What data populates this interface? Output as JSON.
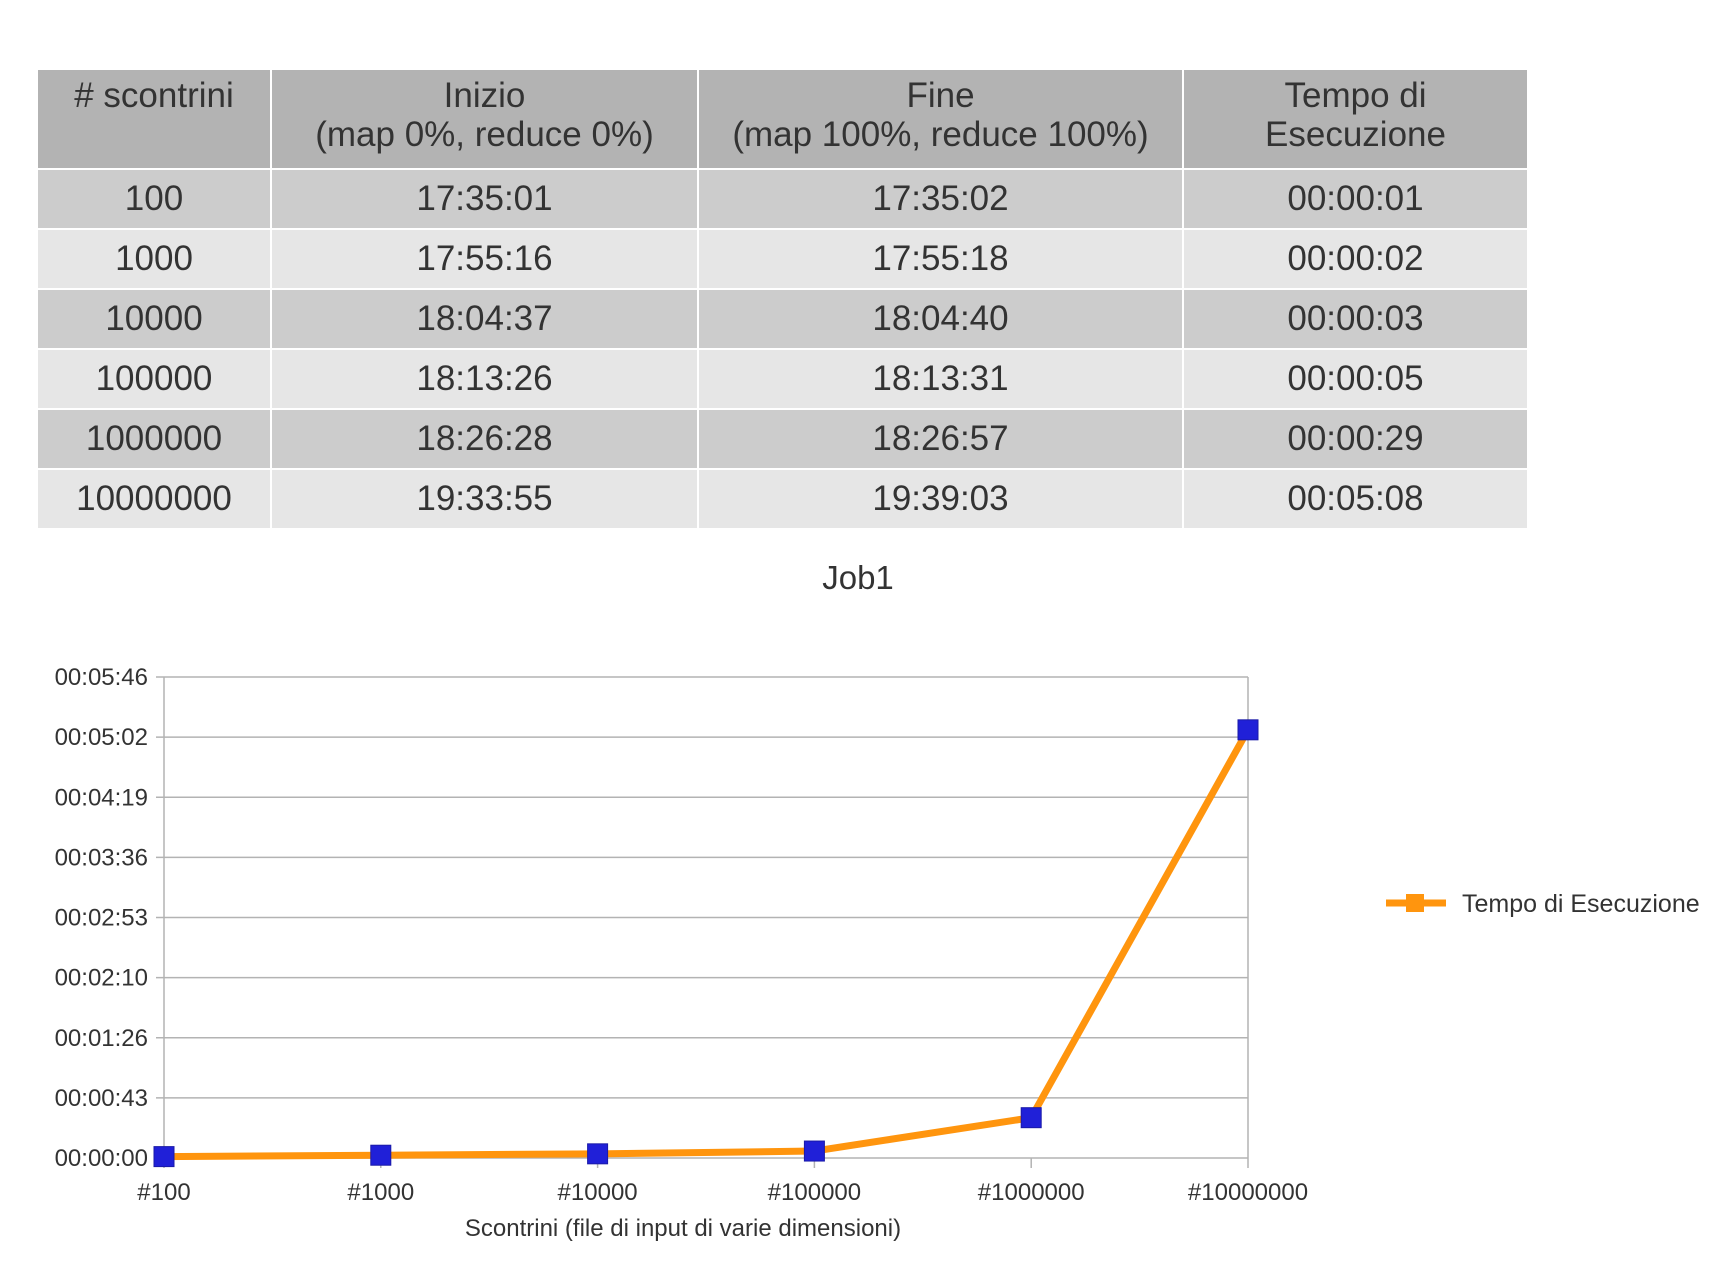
{
  "table": {
    "headers": [
      [
        "# scontrini",
        ""
      ],
      [
        "Inizio",
        "(map 0%, reduce 0%)"
      ],
      [
        "Fine",
        "(map 100%, reduce 100%)"
      ],
      [
        "Tempo di",
        "Esecuzione"
      ]
    ],
    "rows": [
      [
        "100",
        "17:35:01",
        "17:35:02",
        "00:00:01"
      ],
      [
        "1000",
        "17:55:16",
        "17:55:18",
        "00:00:02"
      ],
      [
        "10000",
        "18:04:37",
        "18:04:40",
        "00:00:03"
      ],
      [
        "100000",
        "18:13:26",
        "18:13:31",
        "00:00:05"
      ],
      [
        "1000000",
        "18:26:28",
        "18:26:57",
        "00:00:29"
      ],
      [
        "10000000",
        "19:33:55",
        "19:39:03",
        "00:05:08"
      ]
    ]
  },
  "chart_data": {
    "type": "line",
    "title": "Job1",
    "xlabel": "Scontrini (file di input di varie dimensioni)",
    "ylabel": "",
    "categories": [
      "#100",
      "#1000",
      "#10000",
      "#100000",
      "#1000000",
      "#10000000"
    ],
    "y_ticks": [
      "00:00:00",
      "00:00:43",
      "00:01:26",
      "00:02:10",
      "00:02:53",
      "00:03:36",
      "00:04:19",
      "00:05:02",
      "00:05:46"
    ],
    "ylim_seconds": [
      0,
      346
    ],
    "series": [
      {
        "name": "Tempo di Esecuzione",
        "values_seconds": [
          1,
          2,
          3,
          5,
          29,
          308
        ],
        "line_color": "#ff950e",
        "marker_color": "#2020d8"
      }
    ],
    "grid": true,
    "legend_position": "right"
  }
}
